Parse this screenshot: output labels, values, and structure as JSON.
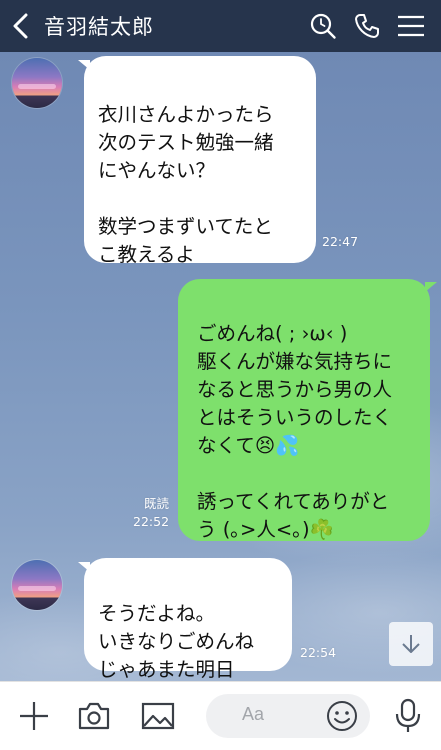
{
  "header": {
    "contact_name": "音羽結太郎"
  },
  "messages": [
    {
      "direction": "incoming",
      "text": "衣川さんよかったら\n次のテスト勉強一緒\nにやんない？\n\n数学つまずいてたと\nこ教えるよ",
      "time": "22:47"
    },
    {
      "direction": "outgoing",
      "text": "ごめんね( ; ›ω‹ )\n駆くんが嫌な気持ちに\nなると思うから男の人\nとはそういうのしたく\nなくて😣💦\n\n誘ってくれてありがと\nう (｡>人<｡)☘️",
      "read_label": "既読",
      "time": "22:52"
    },
    {
      "direction": "incoming",
      "text": "そうだよね。\nいきなりごめんね\nじゃあまた明日",
      "time": "22:54"
    }
  ],
  "input": {
    "placeholder": "Aa"
  },
  "icons": {
    "back": "chevron-left-icon",
    "search": "search-icon",
    "call": "phone-icon",
    "menu": "hamburger-menu-icon",
    "add": "plus-icon",
    "camera": "camera-icon",
    "image": "image-icon",
    "emoji": "smiley-icon",
    "mic": "microphone-icon",
    "scroll": "arrow-down-icon"
  },
  "colors": {
    "header_bg": "#26344c",
    "outgoing_bubble": "#7ee06c",
    "incoming_bubble": "#ffffff"
  }
}
